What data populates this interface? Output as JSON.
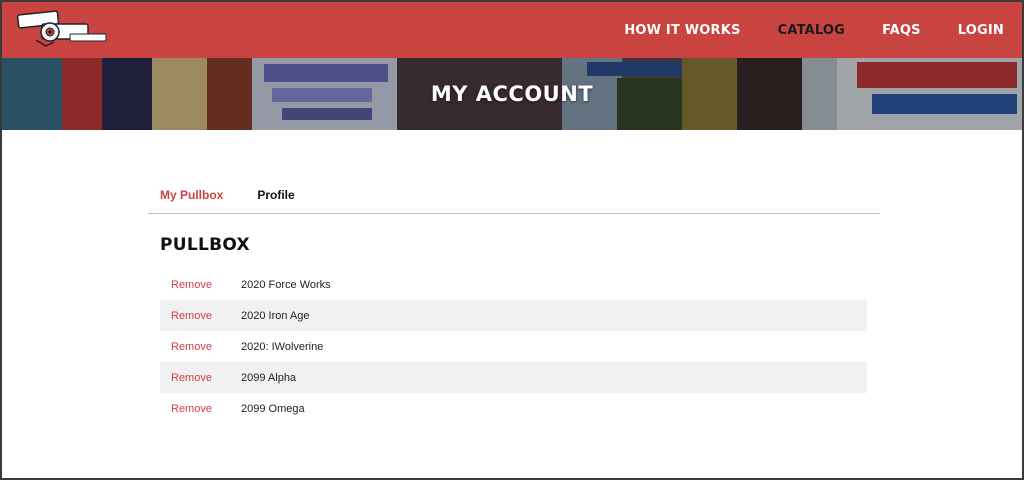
{
  "colors": {
    "brand": "#c94440",
    "nav_active": "#1a1a1a",
    "row_alt": "#f1f1f1"
  },
  "nav": {
    "items": [
      {
        "label": "HOW IT WORKS",
        "active": false
      },
      {
        "label": "CATALOG",
        "active": true
      },
      {
        "label": "FAQS",
        "active": false
      },
      {
        "label": "LOGIN",
        "active": false
      }
    ]
  },
  "hero": {
    "title": "MY ACCOUNT",
    "background_icon": "comic-covers-collage"
  },
  "tabs": [
    {
      "label": "My Pullbox",
      "active": true
    },
    {
      "label": "Profile",
      "active": false
    }
  ],
  "pullbox": {
    "title": "PULLBOX",
    "remove_label": "Remove",
    "items": [
      "2020 Force Works",
      "2020 Iron Age",
      "2020: IWolverine",
      "2099 Alpha",
      "2099 Omega"
    ]
  }
}
